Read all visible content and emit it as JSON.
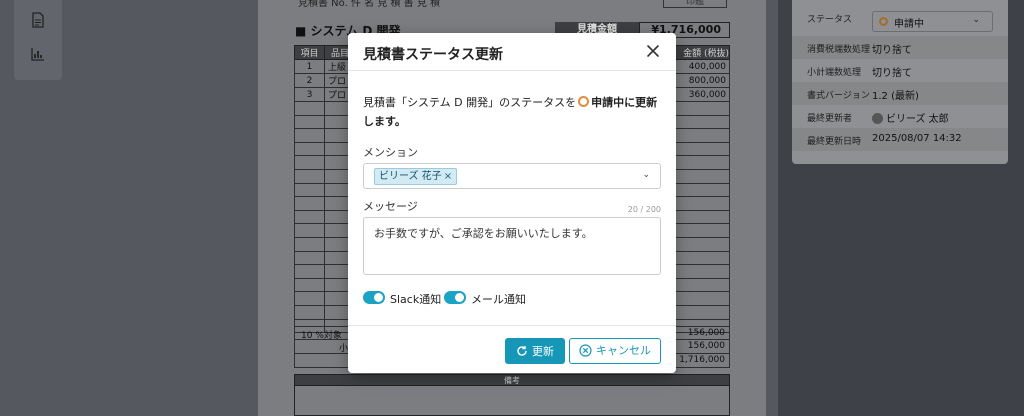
{
  "left_rail": {
    "icons": [
      "document-icon",
      "chart-icon"
    ]
  },
  "document": {
    "top_text": "見積書 No.  件 名 見 積 書 見 積",
    "top_box": "印鑑",
    "title": "■ システム D 開発",
    "sum_label": "見積金額",
    "sum_value": "¥1,716,000",
    "headers": [
      "項目",
      "品目",
      "金額 (税抜)"
    ],
    "rows": [
      {
        "no": "1",
        "item": "上級",
        "amount": "400,000"
      },
      {
        "no": "2",
        "item": "プロ",
        "amount": "800,000"
      },
      {
        "no": "3",
        "item": "プロ",
        "amount": "360,000"
      }
    ],
    "tax_label": "10 %対象",
    "tax_amount": "156,000",
    "subtotal_label": "小",
    "subtotal_amount": "156,000",
    "total_amount": "1,716,000",
    "note_header": "備考"
  },
  "right_panel": {
    "status_label": "ステータス",
    "status_value": "申請中",
    "rows": [
      {
        "label": "消費税端数処理",
        "value": "切り捨て"
      },
      {
        "label": "小計端数処理",
        "value": "切り捨て"
      },
      {
        "label": "書式バージョン",
        "value": "1.2 (最新)"
      },
      {
        "label": "最終更新者",
        "value": "ビリーズ 太郎"
      },
      {
        "label": "最終更新日時",
        "value": "2025/08/07 14:32"
      }
    ]
  },
  "modal": {
    "title": "見積書ステータス更新",
    "desc_before": "見積書「システム D 開発」のステータスを",
    "desc_status": "申請中",
    "desc_after": "に更新します。",
    "mention_label": "メンション",
    "mention_tag": "ビリーズ 花子",
    "message_label": "メッセージ",
    "message_counter": "20 / 200",
    "message_value": "お手数ですが、ご承認をお願いいたします。",
    "slack_label": "Slack通知",
    "mail_label": "メール通知",
    "update_label": "更新",
    "cancel_label": "キャンセル"
  },
  "colors": {
    "accent": "#1697b8",
    "status_ring": "#e08e3c"
  }
}
